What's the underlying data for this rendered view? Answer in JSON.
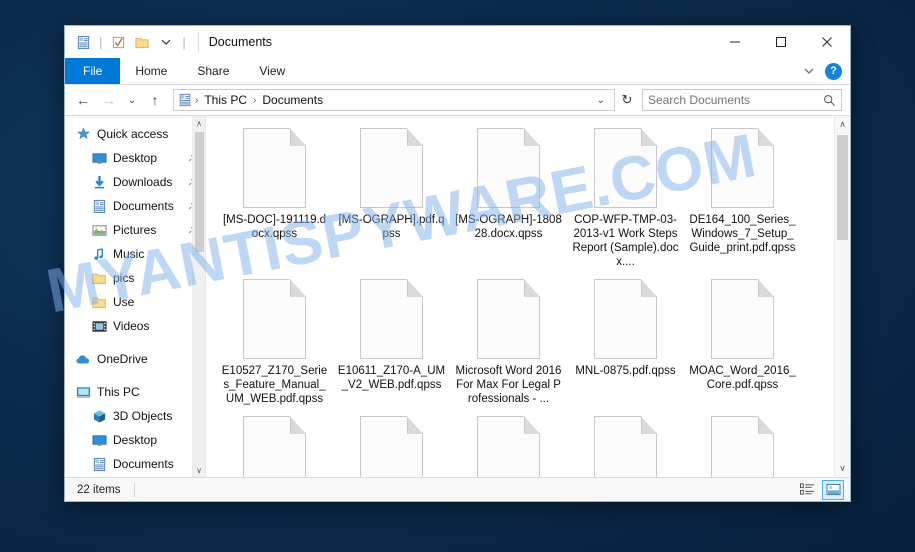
{
  "window": {
    "title": "Documents",
    "quick_access_icons": [
      "documents-icon",
      "checklist-icon",
      "folder-icon",
      "dropdown-arrow-icon"
    ],
    "controls": {
      "minimize": "─",
      "maximize": "☐",
      "close": "✕"
    }
  },
  "ribbon": {
    "tabs": [
      {
        "label": "File",
        "active": true
      },
      {
        "label": "Home",
        "active": false
      },
      {
        "label": "Share",
        "active": false
      },
      {
        "label": "View",
        "active": false
      }
    ],
    "expand_icon": "chevron-down-icon",
    "help_label": "?"
  },
  "addressbar": {
    "back_icon": "←",
    "forward_icon": "→",
    "recent_icon": "⌄",
    "up_icon": "↑",
    "breadcrumb": [
      "This PC",
      "Documents"
    ],
    "separator": "›",
    "dropdown_icon": "⌄",
    "refresh_icon": "↻"
  },
  "search": {
    "placeholder": "Search Documents",
    "value": "",
    "icon": "search-icon"
  },
  "sidebar": {
    "items": [
      {
        "label": "Quick access",
        "icon": "star-icon",
        "level": 0,
        "pinned": false,
        "gap_before": false
      },
      {
        "label": "Desktop",
        "icon": "desktop-icon",
        "level": 1,
        "pinned": true,
        "gap_before": false
      },
      {
        "label": "Downloads",
        "icon": "download-icon",
        "level": 1,
        "pinned": true,
        "gap_before": false
      },
      {
        "label": "Documents",
        "icon": "documents-icon",
        "level": 1,
        "pinned": true,
        "gap_before": false
      },
      {
        "label": "Pictures",
        "icon": "pictures-icon",
        "level": 1,
        "pinned": true,
        "gap_before": false
      },
      {
        "label": "Music",
        "icon": "music-icon",
        "level": 1,
        "pinned": false,
        "gap_before": false
      },
      {
        "label": "pics",
        "icon": "folder-icon",
        "level": 1,
        "pinned": false,
        "gap_before": false
      },
      {
        "label": "Use",
        "icon": "folder-icon",
        "level": 1,
        "pinned": false,
        "gap_before": false
      },
      {
        "label": "Videos",
        "icon": "videos-icon",
        "level": 1,
        "pinned": false,
        "gap_before": false
      },
      {
        "label": "OneDrive",
        "icon": "cloud-icon",
        "level": 0,
        "pinned": false,
        "gap_before": true
      },
      {
        "label": "This PC",
        "icon": "pc-icon",
        "level": 0,
        "pinned": false,
        "gap_before": true
      },
      {
        "label": "3D Objects",
        "icon": "3d-objects-icon",
        "level": 1,
        "pinned": false,
        "gap_before": false
      },
      {
        "label": "Desktop",
        "icon": "desktop-icon",
        "level": 1,
        "pinned": false,
        "gap_before": false
      },
      {
        "label": "Documents",
        "icon": "documents-icon",
        "level": 1,
        "pinned": false,
        "gap_before": false
      }
    ],
    "scroll_up_icon": "∧",
    "scroll_down_icon": "∨"
  },
  "files": [
    {
      "name": "[MS-DOC]-191119.docx.qpss",
      "icon": "blank-document-icon"
    },
    {
      "name": "[MS-OGRAPH].pdf.qpss",
      "icon": "blank-document-icon"
    },
    {
      "name": "[MS-OGRAPH]-180828.docx.qpss",
      "icon": "blank-document-icon"
    },
    {
      "name": "COP-WFP-TMP-03-2013-v1 Work Steps Report (Sample).docx....",
      "icon": "blank-document-icon"
    },
    {
      "name": "DE164_100_Series_Windows_7_Setup_Guide_print.pdf.qpss",
      "icon": "blank-document-icon"
    },
    {
      "name": "E10527_Z170_Series_Feature_Manual_UM_WEB.pdf.qpss",
      "icon": "blank-document-icon"
    },
    {
      "name": "E10611_Z170-A_UM_V2_WEB.pdf.qpss",
      "icon": "blank-document-icon"
    },
    {
      "name": "Microsoft Word 2016 For Max For Legal Professionals - ...",
      "icon": "blank-document-icon"
    },
    {
      "name": "MNL-0875.pdf.qpss",
      "icon": "blank-document-icon"
    },
    {
      "name": "MOAC_Word_2016_Core.pdf.qpss",
      "icon": "blank-document-icon"
    },
    {
      "name": "",
      "icon": "blank-document-icon"
    },
    {
      "name": "",
      "icon": "blank-document-icon"
    },
    {
      "name": "",
      "icon": "blank-document-icon"
    },
    {
      "name": "",
      "icon": "blank-document-icon"
    },
    {
      "name": "",
      "icon": "blank-document-icon"
    }
  ],
  "filepane": {
    "scroll_up_icon": "∧",
    "scroll_down_icon": "∨"
  },
  "statusbar": {
    "item_count": "22 items",
    "views": [
      {
        "icon": "details-view-icon",
        "active": false
      },
      {
        "icon": "large-icons-view-icon",
        "active": true
      }
    ]
  },
  "watermark": {
    "text": "MYANTISPYWARE.COM"
  }
}
